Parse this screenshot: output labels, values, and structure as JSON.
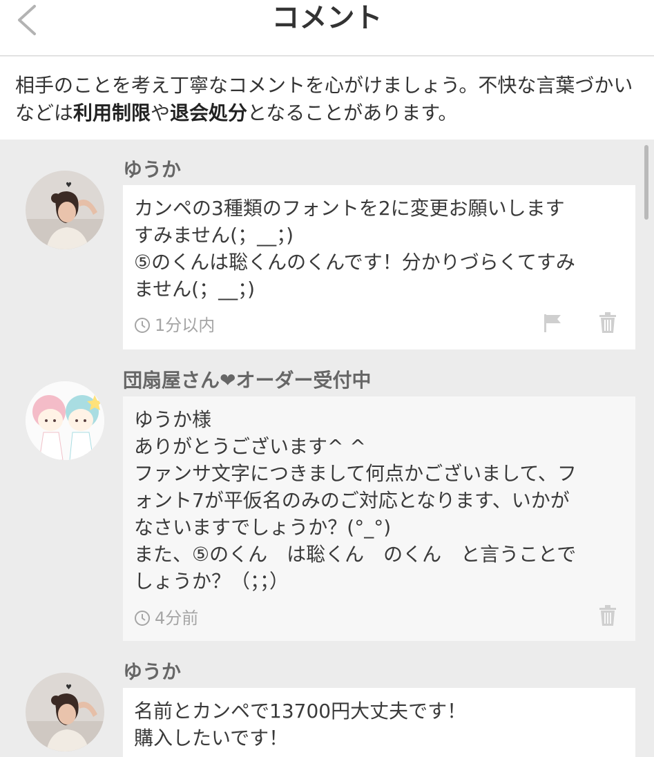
{
  "header": {
    "title": "コメント",
    "back_icon": "chevron-left-icon"
  },
  "notice": {
    "prefix": "相手のことを考え丁寧なコメントを心がけましょう。不快な言葉づかいなどは",
    "bold1": "利用制限",
    "mid": "や",
    "bold2": "退会処分",
    "suffix": "となることがあります。"
  },
  "comments": [
    {
      "user": "ゆうか",
      "lines": [
        "カンペの3種類のフォントを2に変更お願いします",
        "すみません(；__；)",
        "⑤のくんは聡くんのくんです！分かりづらくてすみ",
        "ません(；__；)"
      ],
      "time": "1分以内",
      "icons": [
        "clock-icon",
        "flag-icon",
        "trash-icon"
      ]
    },
    {
      "user": "団扇屋さん❤︎オーダー受付中",
      "lines": [
        "ゆうか様",
        "ありがとうございます^ ^",
        "ファンサ文字につきまして何点かございまして、フ",
        "ォント7が平仮名のみのご対応となります、いかが",
        "なさいますでしょうか？(°_°)",
        "また、⑤のくん　は聡くん　のくん　と言うことで",
        "しょうか？（；；）"
      ],
      "time": "4分前",
      "icons": [
        "clock-icon",
        "trash-icon"
      ]
    },
    {
      "user": "ゆうか",
      "lines": [
        "名前とカンペで13700円大丈夫です！",
        "購入したいです！"
      ]
    }
  ],
  "colors": {
    "page_background": "#ececec",
    "bubble_own": "#ffffff",
    "bubble_seller": "#f7f7f7",
    "muted_text": "#a5a5a5"
  }
}
